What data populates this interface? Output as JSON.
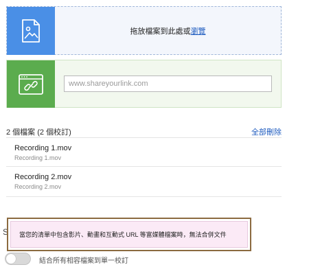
{
  "colors": {
    "drop_accent": "#4a8fe6",
    "link_accent": "#5bac4e",
    "link_text": "#1d5bbf",
    "warning_border": "#8b6a3f",
    "warning_bg": "#fbeaf6"
  },
  "upload": {
    "icon": "image-file-icon",
    "text": "拖放檔案到此處或",
    "browse_label": "瀏覽"
  },
  "link": {
    "icon": "browser-link-icon",
    "placeholder": "www.shareyourlink.com",
    "value": ""
  },
  "files": {
    "count_label": "2 個檔案 (2 個校訂)",
    "remove_all_label": "全部刪除",
    "items": [
      {
        "name": "Recording 1.mov",
        "subtitle": "Recording 1.mov"
      },
      {
        "name": "Recording 2.mov",
        "subtitle": "Recording 2.mov"
      }
    ]
  },
  "warning": {
    "text": "當您的清單中包含影片、動畫和互動式 URL 等富媒體檔案時，無法合併文件",
    "peek_letter": "S"
  },
  "merge": {
    "toggle_on": false,
    "label": "結合所有相容檔案到單一校訂"
  }
}
